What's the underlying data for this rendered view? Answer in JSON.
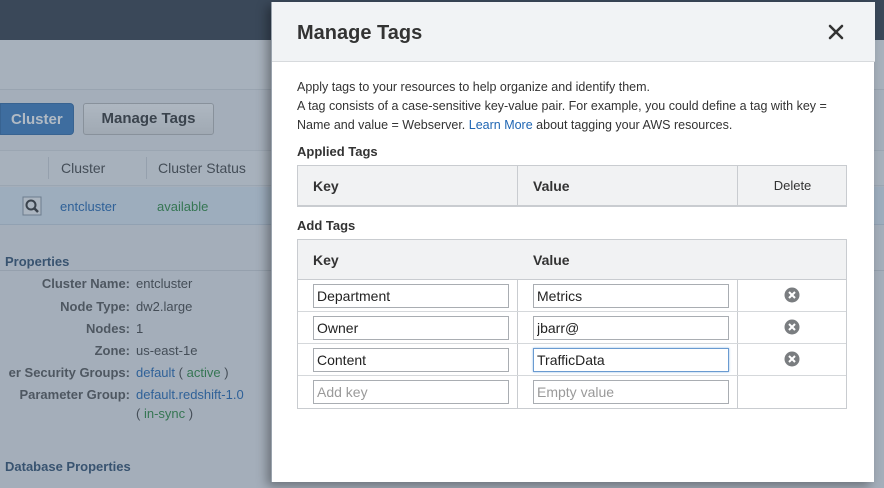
{
  "background": {
    "buttons": {
      "primary": "Cluster",
      "manage_tags": "Manage Tags"
    },
    "table": {
      "headers": [
        "Cluster",
        "Cluster Status"
      ],
      "row": {
        "name": "entcluster",
        "status": "available"
      }
    },
    "properties_title": "Properties",
    "properties": [
      {
        "label": "Cluster Name:",
        "value": "entcluster"
      },
      {
        "label": "Node Type:",
        "value": "dw2.large"
      },
      {
        "label": "Nodes:",
        "value": "1"
      },
      {
        "label": "Zone:",
        "value": "us-east-1e"
      }
    ],
    "security_groups": {
      "label": "er Security Groups:",
      "name": "default",
      "open": "(",
      "state": "active",
      "close": ")"
    },
    "parameter_group": {
      "label": "Parameter Group:",
      "name": "default.redshift-1.0",
      "open": "(",
      "state": "in-sync",
      "close": ")"
    },
    "database_properties_title": "Database Properties"
  },
  "modal": {
    "title": "Manage Tags",
    "description": {
      "line1": "Apply tags to your resources to help organize and identify them.",
      "line2a": "A tag consists of a case-sensitive key-value pair. For example, you could define a tag with key = Name and value = Webserver.",
      "link": "Learn More",
      "line2b": "about tagging your AWS resources."
    },
    "applied_tags": {
      "label": "Applied Tags",
      "headers": {
        "key": "Key",
        "value": "Value",
        "delete": "Delete"
      }
    },
    "add_tags": {
      "label": "Add Tags",
      "headers": {
        "key": "Key",
        "value": "Value"
      },
      "rows": [
        {
          "key": "Department",
          "value": "Metrics"
        },
        {
          "key": "Owner",
          "value": "jbarr@"
        },
        {
          "key": "Content",
          "value": "TrafficData"
        }
      ],
      "new_row": {
        "key_placeholder": "Add key",
        "value_placeholder": "Empty value"
      }
    }
  },
  "colors": {
    "link": "#1f66b3",
    "active": "#2b8a3e",
    "topbar": "#333c47",
    "primary_button": "#3a7bbf"
  }
}
